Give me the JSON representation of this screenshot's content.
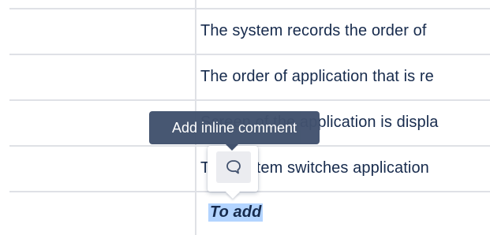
{
  "table": {
    "rows": [
      {
        "text": "The system records the order of "
      },
      {
        "text": "The order of application that is re"
      },
      {
        "text": "Screen of the application is displa"
      },
      {
        "text": "The system switches application"
      },
      {
        "text": "To add"
      }
    ]
  },
  "tooltip": {
    "label": "Add inline comment"
  },
  "comment_button": {
    "icon": "comment-bubble-icon"
  },
  "colors": {
    "table_border": "#dfe1e6",
    "text": "#172b4d",
    "selection": "#b3d4ff",
    "tooltip_bg": "#42526e",
    "button_bg": "#ebecf0"
  }
}
